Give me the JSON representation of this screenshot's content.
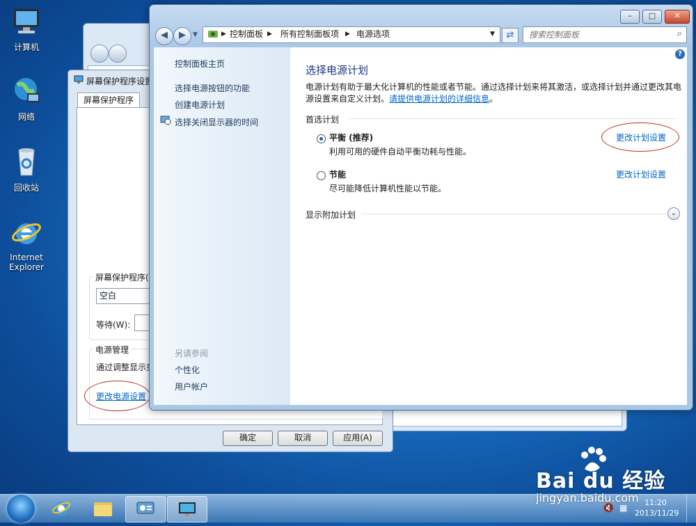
{
  "desktop": {
    "icons": [
      {
        "label": "计算机"
      },
      {
        "label": "网络"
      },
      {
        "label": "回收站"
      },
      {
        "label": "Internet Explorer"
      }
    ]
  },
  "screensaver_dialog": {
    "title": "屏幕保护程序设置",
    "tab": "屏幕保护程序",
    "screensaver_group_label": "屏幕保护程序(S",
    "screensaver_value": "空白",
    "wait_label": "等待(W):",
    "power_group_label": "电源管理",
    "power_desc": "通过调整显示亮",
    "power_link": "更改电源设置",
    "ok": "确定",
    "cancel": "取消",
    "apply": "应用(A)"
  },
  "control_panel": {
    "breadcrumb": [
      "控制面板",
      "所有控制面板项",
      "电源选项"
    ],
    "search_placeholder": "搜索控制面板",
    "window_buttons": {
      "minimize": "–",
      "maximize": "□",
      "close": "✕"
    },
    "sidebar": {
      "home": "控制面板主页",
      "links": [
        "选择电源按钮的功能",
        "创建电源计划",
        "选择关闭显示器的时间"
      ],
      "see_also_title": "另请参阅",
      "see_also": [
        "个性化",
        "用户帐户"
      ]
    },
    "main": {
      "title": "选择电源计划",
      "desc_line1": "电源计划有助于最大化计算机的性能或者节能。通过选择计划来将其激活，或选择计划并通过更改其电",
      "desc_line2": "源设置来自定义计划。",
      "desc_link": "请提供电源计划的详细信息",
      "desc_end": "。",
      "preferred_label": "首选计划",
      "plans": [
        {
          "name": "平衡 (推荐)",
          "desc": "利用可用的硬件自动平衡功耗与性能。",
          "selected": true,
          "link": "更改计划设置"
        },
        {
          "name": "节能",
          "desc": "尽可能降低计算机性能以节能。",
          "selected": false,
          "link": "更改计划设置"
        }
      ],
      "additional_plans": "显示附加计划"
    }
  },
  "taskbar": {
    "clock_time": "11:20",
    "clock_date": "2013/11/29"
  },
  "watermark": {
    "brand": "Bai du 经验",
    "url": "jingyan.baidu.com"
  }
}
